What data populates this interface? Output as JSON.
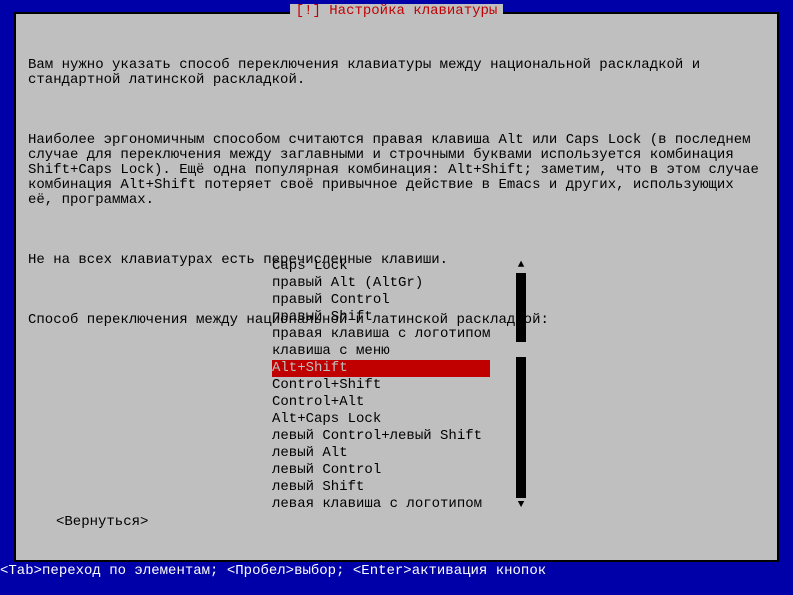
{
  "dialog": {
    "title": "[!] Настройка клавиатуры",
    "para1": "Вам нужно указать способ переключения клавиатуры между национальной раскладкой и стандартной латинской раскладкой.",
    "para2": "Наиболее эргономичным способом считаются правая клавиша Alt или Caps Lock (в последнем случае для переключения между заглавными и строчными буквами используется комбинация Shift+Caps Lock). Ещё одна популярная комбинация: Alt+Shift; заметим, что в этом случае комбинация Alt+Shift потеряет своё привычное действие в Emacs и других, использующих её, программах.",
    "para3": "Не на всех клавиатурах есть перечисленные клавиши.",
    "prompt": "Способ переключения между национальной и латинской раскладкой:"
  },
  "list": {
    "items": [
      "Caps Lock",
      "правый Alt (AltGr)",
      "правый Control",
      "правый Shift",
      "правая клавиша с логотипом",
      "клавиша с меню",
      "Alt+Shift",
      "Control+Shift",
      "Control+Alt",
      "Alt+Caps Lock",
      "левый Control+левый Shift",
      "левый Alt",
      "левый Control",
      "левый Shift",
      "левая клавиша с логотипом"
    ],
    "selected_index": 6
  },
  "back_button": "<Вернуться>",
  "footer": {
    "tab_key": "<Tab>",
    "tab_text": "переход по элементам; ",
    "space_key": "<Пробел>",
    "space_text": "выбор; ",
    "enter_key": "<Enter>",
    "enter_text": "активация кнопок"
  },
  "colors": {
    "background": "#0000a8",
    "panel": "#bfbfbf",
    "accent": "#c00000"
  }
}
